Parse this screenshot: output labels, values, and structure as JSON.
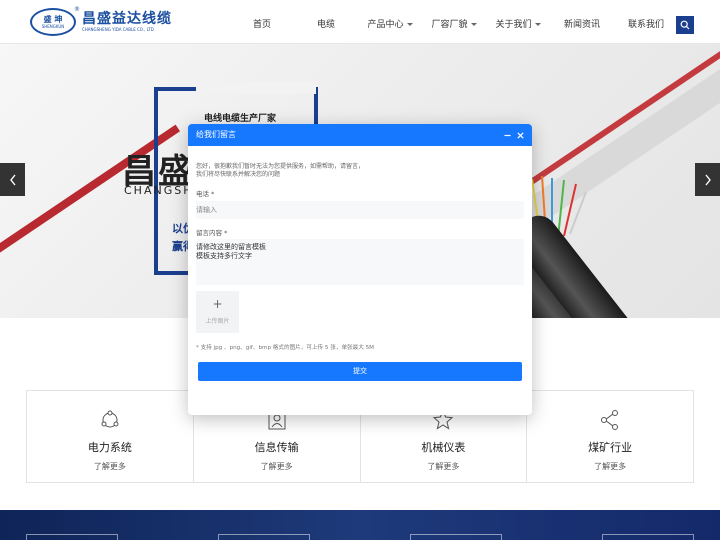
{
  "header": {
    "logo": {
      "badge_cn": "盛 坤",
      "badge_en": "SHENGKUN",
      "brand_cn": "昌盛益达线缆",
      "brand_en": "CHANGSHENG YIDA CABLE CO., LTD",
      "reg_mark": "®"
    },
    "nav": [
      {
        "label": "首页",
        "caret": false
      },
      {
        "label": "电缆",
        "caret": false
      },
      {
        "label": "产品中心",
        "caret": true
      },
      {
        "label": "厂容厂貌",
        "caret": true
      },
      {
        "label": "关于我们",
        "caret": true
      },
      {
        "label": "新闻资讯",
        "caret": false
      },
      {
        "label": "联系我们",
        "caret": false
      }
    ],
    "search_icon": "search-icon"
  },
  "banner": {
    "tag": "电线电缆生产厂家",
    "big_text": "昌盛",
    "en_text": "CHANGSH",
    "sub_line1": "以优",
    "sub_line2": "赢得",
    "prev_icon": "chevron-left-icon",
    "next_icon": "chevron-right-icon"
  },
  "modal": {
    "title": "给我们留言",
    "minimize_icon": "minimize-icon",
    "close_icon": "close-icon",
    "desc_line1": "您好，很抱歉我们暂时无法为您提供服务，如需帮助，请留言，",
    "desc_line2": "我们将尽快联系并解决您的问题",
    "phone_label": "电话",
    "phone_placeholder": "请输入",
    "message_label": "留言内容",
    "message_line1": "请修改这里的留言模板",
    "message_line2": "模板支持多行文字",
    "required_mark": "*",
    "upload_plus": "+",
    "upload_label": "上传图片",
    "hint": "* 支持 jpg 、png、gif、bmp 格式的图片，可上传 5 张，单张最大 5M",
    "submit_label": "提交"
  },
  "cards": [
    {
      "icon": "power-network-icon",
      "title": "电力系统",
      "more": "了解更多"
    },
    {
      "icon": "person-id-icon",
      "title": "信息传输",
      "more": "了解更多"
    },
    {
      "icon": "star-icon",
      "title": "机械仪表",
      "more": "了解更多"
    },
    {
      "icon": "share-nodes-icon",
      "title": "煤矿行业",
      "more": "了解更多"
    }
  ],
  "colors": {
    "primary_blue": "#1677ff",
    "brand_navy": "#1b3f8f",
    "accent_red": "#b82a2f"
  }
}
